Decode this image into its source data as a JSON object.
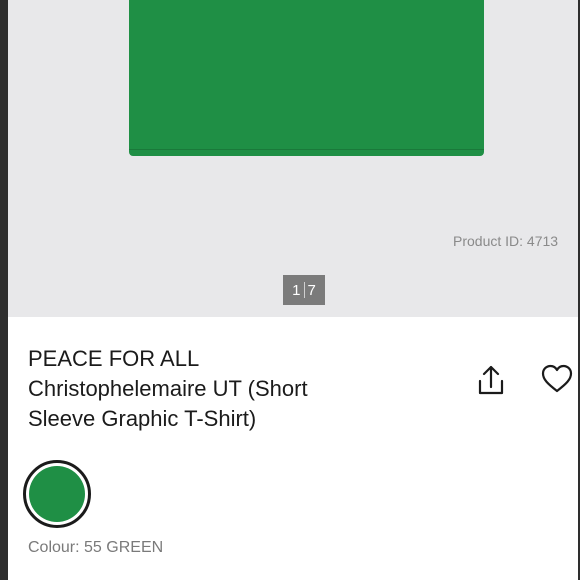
{
  "gallery": {
    "product_id": "Product ID: 4713",
    "pager": {
      "current": "1",
      "total": "7"
    },
    "image_icon": "product-image"
  },
  "product": {
    "title_line1": "PEACE FOR ALL",
    "title_line2": "Christophelemaire UT (Short",
    "title_line3": "Sleeve Graphic T-Shirt)",
    "share_icon": "share-icon",
    "favorite_icon": "heart-icon"
  },
  "colour": {
    "swatch_color": "#1f8f45",
    "label": "Colour: 55 GREEN"
  }
}
